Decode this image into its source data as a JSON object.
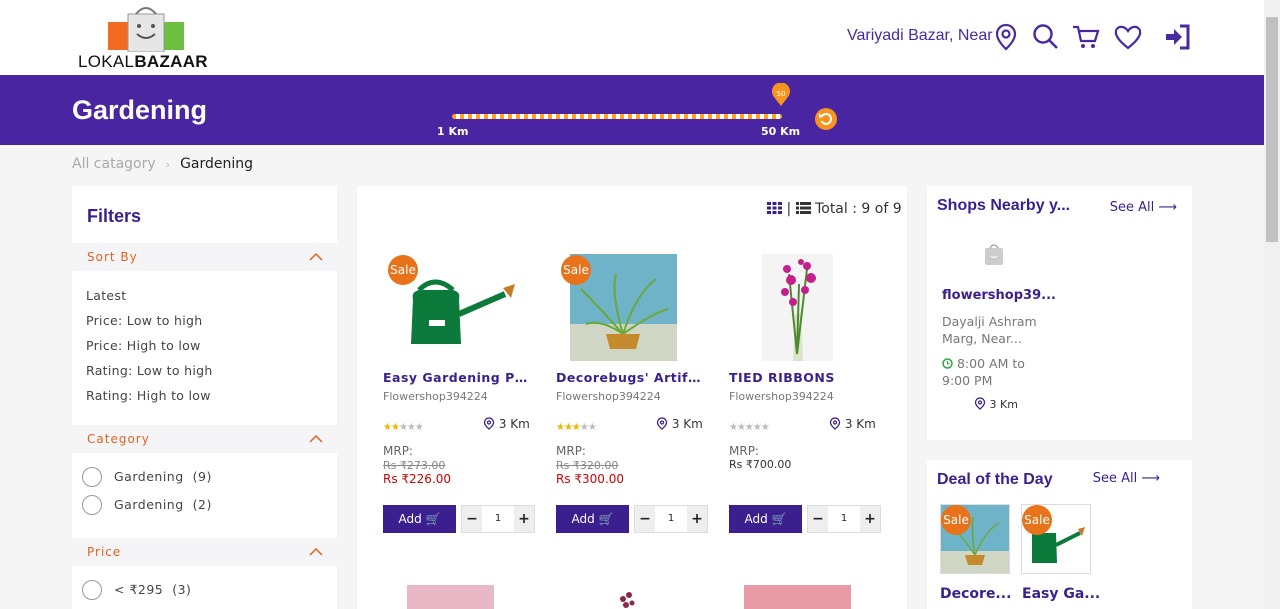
{
  "header": {
    "logo_prefix": "LOKAL",
    "logo_suffix": "BAZAAR",
    "location": "Variyadi Bazar, Near",
    "icons": [
      "location-pin-icon",
      "search-icon",
      "cart-icon",
      "heart-icon",
      "login-icon"
    ]
  },
  "banner": {
    "title": "Gardening",
    "slider_value": "50",
    "slider_min_label": "1 Km",
    "slider_max_label": "50 Km",
    "slider_fraction": 1.0
  },
  "breadcrumb": {
    "parent": "All catagory",
    "current": "Gardening"
  },
  "filters": {
    "title": "Filters",
    "sort_heading": "Sort By",
    "sort_options": [
      "Latest",
      "Price: Low to high",
      "Price: High to low",
      "Rating: Low to high",
      "Rating: High to low"
    ],
    "category_heading": "Category",
    "categories": [
      {
        "label": "Gardening",
        "count": "(9)"
      },
      {
        "label": "Gardening",
        "count": "(2)"
      }
    ],
    "price_heading": "Price",
    "prices": [
      {
        "label": "< ₹295",
        "count": "(3)"
      }
    ]
  },
  "products": {
    "total_label": "Total : 9 of 9",
    "items": [
      {
        "name": "Easy Gardening Pla...",
        "shop": "Flowershop394224",
        "rating": 2,
        "distance": "3 Km",
        "mrp_label": "MRP:",
        "old_price": "Rs ₹273.00",
        "price": "Rs ₹226.00",
        "sale": "Sale",
        "add_label": "Add",
        "qty": "1"
      },
      {
        "name": "Decorebugs' Artifi...",
        "shop": "Flowershop394224",
        "rating": 3,
        "distance": "3 Km",
        "mrp_label": "MRP:",
        "old_price": "Rs ₹320.00",
        "price": "Rs ₹300.00",
        "sale": "Sale",
        "add_label": "Add",
        "qty": "1"
      },
      {
        "name": "TIED RIBBONS",
        "shop": "Flowershop394224",
        "rating": 0,
        "distance": "3 Km",
        "mrp_label": "MRP:",
        "old_price": "",
        "price": "Rs ₹700.00",
        "sale": "",
        "add_label": "Add",
        "qty": "1"
      }
    ]
  },
  "nearby": {
    "title": "Shops Nearby y...",
    "see_all": "See All",
    "shop": {
      "name": "flowershop39...",
      "address": "Dayalji Ashram Marg, Near...",
      "hours": "8:00 AM to 9:00 PM",
      "distance": "3 Km"
    }
  },
  "deal": {
    "title": "Deal of the Day",
    "see_all": "See All",
    "items": [
      {
        "name": "Decore...",
        "sale": "Sale"
      },
      {
        "name": "Easy Ga...",
        "sale": "Sale"
      }
    ]
  },
  "colors": {
    "brand": "#4a25a2",
    "accent": "#f7941d",
    "sale": "#e8731b",
    "price": "#cc0000"
  }
}
